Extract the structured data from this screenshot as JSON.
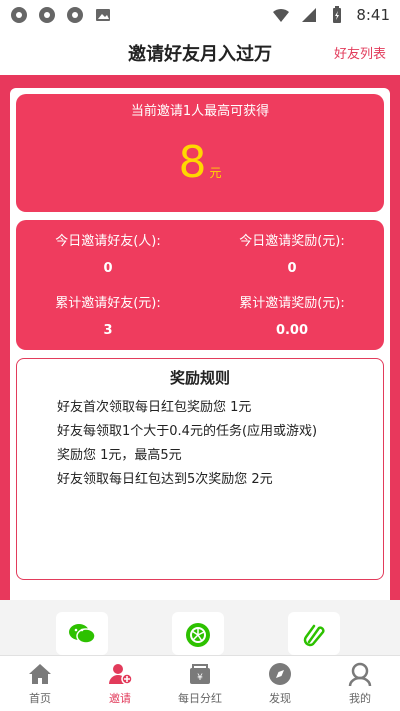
{
  "statusbar": {
    "time": "8:41",
    "icons": [
      "app-icon-1",
      "app-icon-2",
      "app-icon-3",
      "image-icon",
      "wifi-icon",
      "signal-icon",
      "battery-icon"
    ]
  },
  "header": {
    "title": "邀请好友月入过万",
    "friend_list": "好友列表"
  },
  "hero": {
    "subtitle": "当前邀请1人最高可获得",
    "amount": "8",
    "unit": "元"
  },
  "stats": {
    "today_friends_label": "今日邀请好友(人):",
    "today_friends_value": "0",
    "today_reward_label": "今日邀请奖励(元):",
    "today_reward_value": "0",
    "total_friends_label": "累计邀请好友(元):",
    "total_friends_value": "3",
    "total_reward_label": "累计邀请奖励(元):",
    "total_reward_value": "0.00"
  },
  "rules": {
    "title": "奖励规则",
    "items": [
      "好友首次领取每日红包奖励您 1元",
      "好友每领取1个大于0.4元的任务(应用或游戏)",
      "奖励您 1元，最高5元",
      "好友领取每日红包达到5次奖励您 2元"
    ]
  },
  "share": {
    "icons": [
      "wechat-icon",
      "moments-icon",
      "link-icon"
    ]
  },
  "tabs": [
    {
      "label": "首页",
      "icon": "home-icon"
    },
    {
      "label": "邀请",
      "icon": "invite-user-icon"
    },
    {
      "label": "每日分红",
      "icon": "dividend-icon"
    },
    {
      "label": "发现",
      "icon": "compass-icon"
    },
    {
      "label": "我的",
      "icon": "profile-icon"
    }
  ],
  "colors": {
    "accent": "#e8385c",
    "card": "#ef3c5e",
    "gold": "#ffd700",
    "wechat_green": "#2dc100"
  }
}
